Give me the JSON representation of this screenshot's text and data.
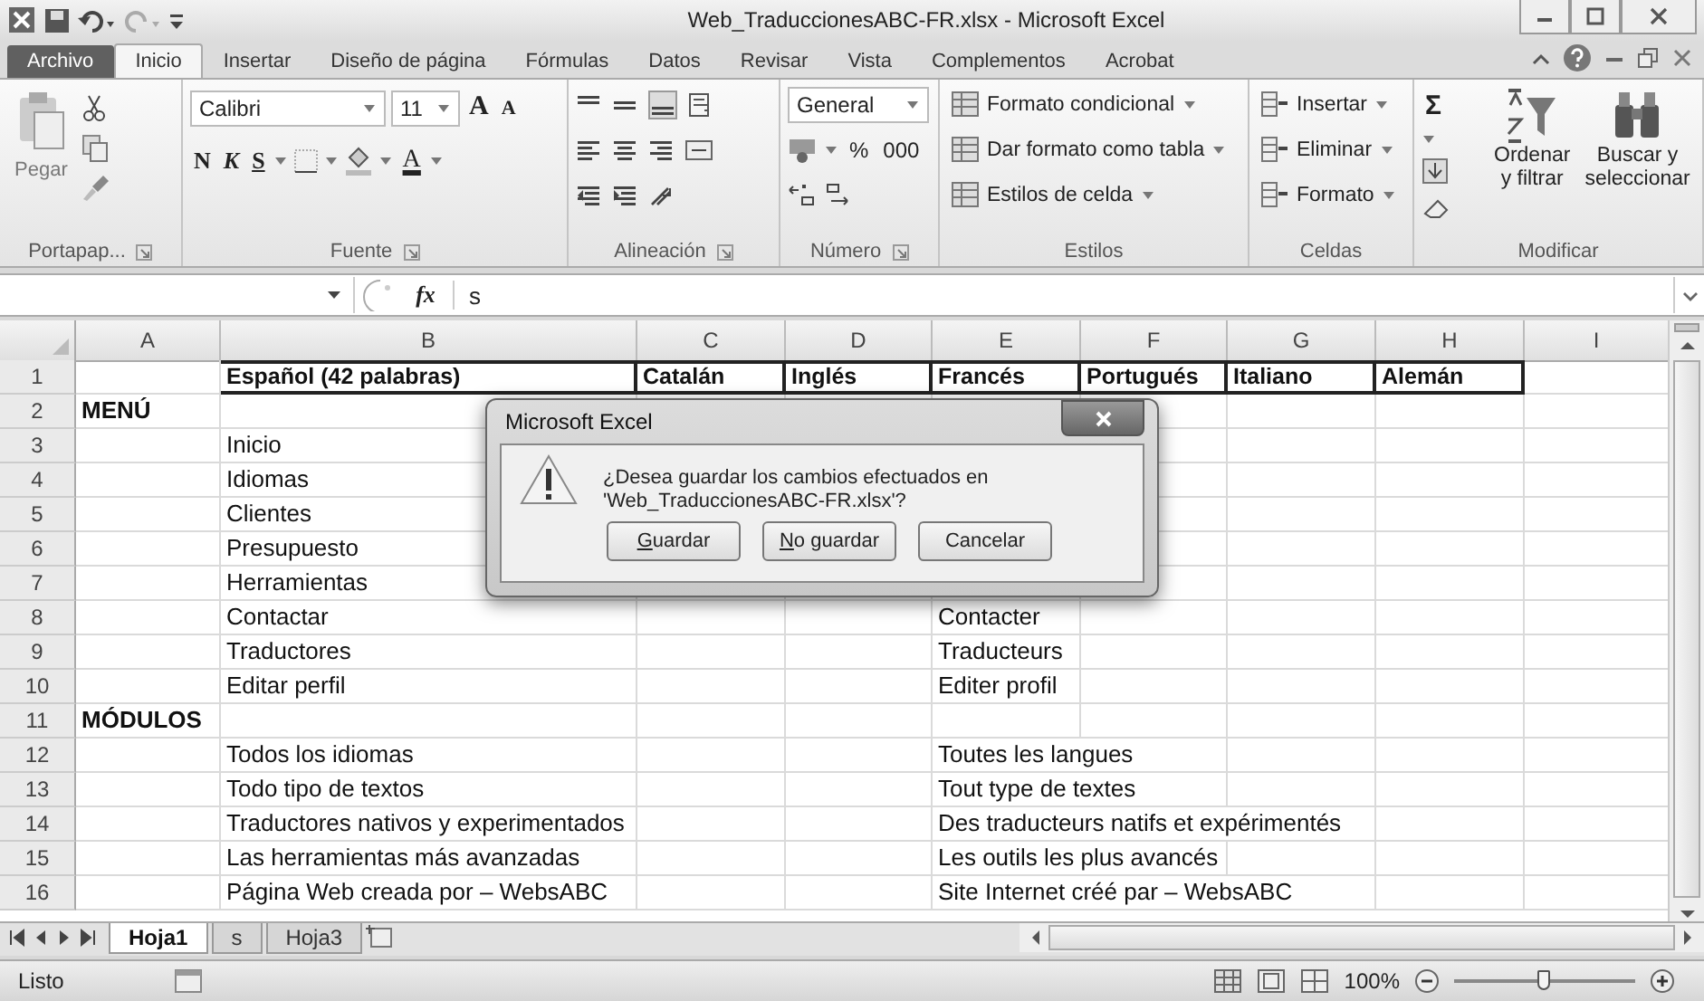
{
  "window": {
    "title": "Web_TraduccionesABC-FR.xlsx - Microsoft Excel"
  },
  "tabs": [
    {
      "label": "Archivo",
      "kind": "file",
      "selected": false
    },
    {
      "label": "Inicio",
      "kind": "tab",
      "selected": true
    },
    {
      "label": "Insertar",
      "kind": "tab",
      "selected": false
    },
    {
      "label": "Diseño de página",
      "kind": "tab",
      "selected": false
    },
    {
      "label": "Fórmulas",
      "kind": "tab",
      "selected": false
    },
    {
      "label": "Datos",
      "kind": "tab",
      "selected": false
    },
    {
      "label": "Revisar",
      "kind": "tab",
      "selected": false
    },
    {
      "label": "Vista",
      "kind": "tab",
      "selected": false
    },
    {
      "label": "Complementos",
      "kind": "tab",
      "selected": false
    },
    {
      "label": "Acrobat",
      "kind": "tab",
      "selected": false
    }
  ],
  "ribbon": {
    "clipboard": {
      "label": "Portapap...",
      "paste": "Pegar"
    },
    "font": {
      "label": "Fuente",
      "font_name": "Calibri",
      "font_size": "11",
      "grow": "A",
      "shrink": "A",
      "bold": "N",
      "italic": "K",
      "underline": "S",
      "font_color": "A"
    },
    "alignment": {
      "label": "Alineación"
    },
    "number": {
      "label": "Número",
      "format": "General",
      "percent": "%",
      "thousands": "000"
    },
    "styles": {
      "label": "Estilos",
      "items": [
        "Formato condicional",
        "Dar formato como tabla",
        "Estilos de celda"
      ]
    },
    "cells": {
      "label": "Celdas",
      "items": [
        "Insertar",
        "Eliminar",
        "Formato"
      ]
    },
    "editing": {
      "label": "Modificar",
      "autosum": "Σ",
      "sort": [
        "Ordenar",
        "y filtrar"
      ],
      "find": [
        "Buscar y",
        "seleccionar"
      ]
    }
  },
  "formula_bar": {
    "function_label": "fx",
    "value": "s"
  },
  "columns": [
    "A",
    "B",
    "C",
    "D",
    "E",
    "F",
    "G",
    "H",
    "I"
  ],
  "rows": [
    {
      "number": "1",
      "kind": "heading",
      "cells": {
        "B": "Español (42 palabras)",
        "C": "Catalán",
        "D": "Inglés",
        "E": "Francés",
        "F": "Portugués",
        "G": "Italiano",
        "H": "Alemán"
      }
    },
    {
      "number": "2",
      "kind": "section",
      "cells": {
        "A": "MENÚ"
      }
    },
    {
      "number": "3",
      "kind": "item",
      "cells": {
        "B": "Inicio"
      }
    },
    {
      "number": "4",
      "kind": "item",
      "cells": {
        "B": "Idiomas"
      }
    },
    {
      "number": "5",
      "kind": "item",
      "cells": {
        "B": "Clientes"
      }
    },
    {
      "number": "6",
      "kind": "item",
      "cells": {
        "B": "Presupuesto"
      }
    },
    {
      "number": "7",
      "kind": "item",
      "cells": {
        "B": "Herramientas"
      }
    },
    {
      "number": "8",
      "kind": "item",
      "cells": {
        "B": "Contactar",
        "E": "Contacter"
      }
    },
    {
      "number": "9",
      "kind": "item",
      "cells": {
        "B": "Traductores",
        "E": "Traducteurs"
      }
    },
    {
      "number": "10",
      "kind": "item",
      "cells": {
        "B": "Editar perfil",
        "E": "Editer profil"
      }
    },
    {
      "number": "11",
      "kind": "section",
      "cells": {
        "A": "MÓDULOS"
      }
    },
    {
      "number": "12",
      "kind": "item",
      "cells": {
        "B": "Todos los idiomas",
        "E": "Toutes les langues"
      }
    },
    {
      "number": "13",
      "kind": "item",
      "cells": {
        "B": "Todo tipo de textos",
        "E": "Tout type de textes"
      }
    },
    {
      "number": "14",
      "kind": "item",
      "cells": {
        "B": "Traductores nativos y experimentados",
        "E": "Des traducteurs natifs et expérimentés"
      }
    },
    {
      "number": "15",
      "kind": "item",
      "cells": {
        "B": "Las herramientas más avanzadas",
        "E": "Les outils les plus avancés"
      }
    },
    {
      "number": "16",
      "kind": "item",
      "cells": {
        "B": "Página Web creada por – WebsABC",
        "E": "Site Internet créé par – WebsABC"
      }
    }
  ],
  "sheet_tabs": [
    {
      "label": "Hoja1",
      "selected": true
    },
    {
      "label": "s",
      "selected": false
    },
    {
      "label": "Hoja3",
      "selected": false
    }
  ],
  "status_bar": {
    "status": "Listo",
    "zoom": "100%",
    "zoom_slider": {
      "level": 0.5
    }
  },
  "dialog": {
    "title": "Microsoft Excel",
    "message": "¿Desea guardar los cambios efectuados en 'Web_TraduccionesABC-FR.xlsx'?",
    "buttons": [
      {
        "label": "Guardar",
        "mnemonic": true
      },
      {
        "label": "No guardar",
        "mnemonic": true
      },
      {
        "label": "Cancelar",
        "mnemonic": false
      }
    ]
  }
}
